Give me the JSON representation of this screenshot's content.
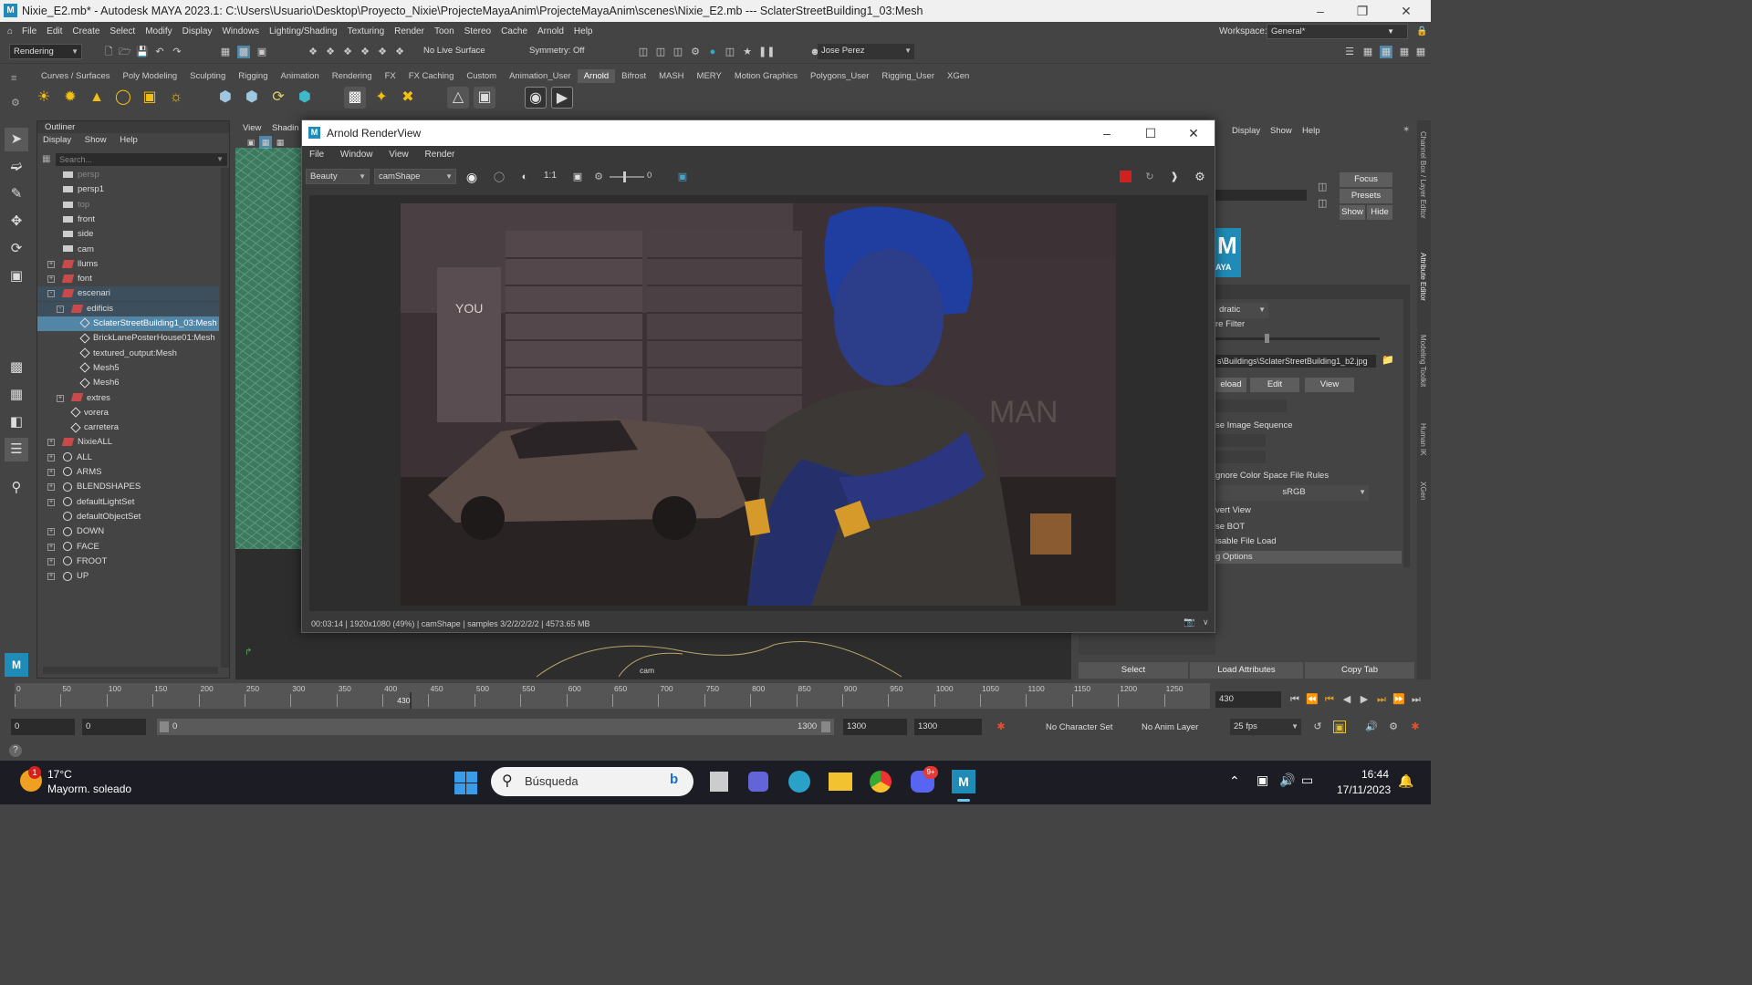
{
  "window": {
    "title": "Nixie_E2.mb* - Autodesk MAYA 2023.1: C:\\Users\\Usuario\\Desktop\\Proyecto_Nixie\\ProjecteMayaAnim\\ProjecteMayaAnim\\scenes\\Nixie_E2.mb   ---   SclaterStreetBuilding1_03:Mesh",
    "logo": "M"
  },
  "menubar": {
    "items": [
      "File",
      "Edit",
      "Create",
      "Select",
      "Modify",
      "Display",
      "Windows",
      "Lighting/Shading",
      "Texturing",
      "Render",
      "Toon",
      "Stereo",
      "Cache",
      "Arnold",
      "Help"
    ],
    "workspace_label": "Workspace:",
    "workspace_value": "General*"
  },
  "statusline": {
    "menuset": "Rendering",
    "live_surface": "No Live Surface",
    "symmetry": "Symmetry: Off",
    "user": "Jose Perez"
  },
  "shelf": {
    "tabs": [
      "Curves / Surfaces",
      "Poly Modeling",
      "Sculpting",
      "Rigging",
      "Animation",
      "Rendering",
      "FX",
      "FX Caching",
      "Custom",
      "Animation_User",
      "Arnold",
      "Bifrost",
      "MASH",
      "MERY",
      "Motion Graphics",
      "Polygons_User",
      "Rigging_User",
      "XGen"
    ],
    "active_tab": "Arnold"
  },
  "outliner": {
    "title": "Outliner",
    "menu": [
      "Display",
      "Show",
      "Help"
    ],
    "search_placeholder": "Search...",
    "items": [
      {
        "label": "persp",
        "type": "camera",
        "indent": 0,
        "dim": true
      },
      {
        "label": "persp1",
        "type": "camera",
        "indent": 0
      },
      {
        "label": "top",
        "type": "camera",
        "indent": 0,
        "dim": true
      },
      {
        "label": "front",
        "type": "camera",
        "indent": 0
      },
      {
        "label": "side",
        "type": "camera",
        "indent": 0
      },
      {
        "label": "cam",
        "type": "camera",
        "indent": 0
      },
      {
        "label": "llums",
        "type": "group",
        "indent": 0,
        "expand": "+"
      },
      {
        "label": "font",
        "type": "group",
        "indent": 0,
        "expand": "+"
      },
      {
        "label": "escenari",
        "type": "group",
        "indent": 0,
        "expand": "-",
        "grp": true
      },
      {
        "label": "edificis",
        "type": "group",
        "indent": 1,
        "expand": "-",
        "grp": true
      },
      {
        "label": "SclaterStreetBuilding1_03:Mesh",
        "type": "mesh",
        "indent": 2,
        "selected": true
      },
      {
        "label": "BrickLanePosterHouse01:Mesh",
        "type": "mesh",
        "indent": 2
      },
      {
        "label": "textured_output:Mesh",
        "type": "mesh",
        "indent": 2
      },
      {
        "label": "Mesh5",
        "type": "mesh",
        "indent": 2
      },
      {
        "label": "Mesh6",
        "type": "mesh",
        "indent": 2
      },
      {
        "label": "extres",
        "type": "group",
        "indent": 1,
        "expand": "+"
      },
      {
        "label": "vorera",
        "type": "mesh",
        "indent": 1
      },
      {
        "label": "carretera",
        "type": "mesh",
        "indent": 1
      },
      {
        "label": "NixieALL",
        "type": "group",
        "indent": 0,
        "expand": "+"
      },
      {
        "label": "ALL",
        "type": "set",
        "indent": 0,
        "expand": "+"
      },
      {
        "label": "ARMS",
        "type": "set",
        "indent": 0,
        "expand": "+"
      },
      {
        "label": "BLENDSHAPES",
        "type": "set",
        "indent": 0,
        "expand": "+"
      },
      {
        "label": "defaultLightSet",
        "type": "set",
        "indent": 0,
        "expand": "+"
      },
      {
        "label": "defaultObjectSet",
        "type": "set",
        "indent": 0
      },
      {
        "label": "DOWN",
        "type": "set",
        "indent": 0,
        "expand": "+"
      },
      {
        "label": "FACE",
        "type": "set",
        "indent": 0,
        "expand": "+"
      },
      {
        "label": "FROOT",
        "type": "set",
        "indent": 0,
        "expand": "+"
      },
      {
        "label": "UP",
        "type": "set",
        "indent": 0,
        "expand": "+"
      }
    ]
  },
  "viewport": {
    "menu": [
      "View",
      "Shadin"
    ],
    "camera_label": "cam"
  },
  "arnold": {
    "title": "Arnold RenderView",
    "menu": [
      "File",
      "Window",
      "View",
      "Render"
    ],
    "aov": "Beauty",
    "camera": "camShape",
    "zoom": "1:1",
    "exposure": "0",
    "status": "00:03:14 | 1920x1080 (49%) | camShape  | samples 3/2/2/2/2/2 | 4573.65 MB",
    "graffiti_1": "YOU",
    "graffiti_2": "MAN"
  },
  "right_panel": {
    "menu": [
      "Display",
      "Show",
      "Help"
    ],
    "buttons": [
      "Focus",
      "Presets",
      "Show",
      "Hide"
    ],
    "maya_logo": "M",
    "maya_text": "AYA",
    "filter_type": "dratic",
    "filter_label": "re Filter",
    "file_path": "s\\Buildings\\SclaterStreetBuilding1_b2.jpg",
    "file_buttons": [
      "eload",
      "Edit",
      "View"
    ],
    "use_image_seq": "se Image Sequence",
    "ignore_cs": "gnore Color Space File Rules",
    "color_space": "sRGB",
    "invert_view": "vert View",
    "use_bot": "se BOT",
    "disable_load": "isable File Load",
    "options": "g Options",
    "bottom_buttons": [
      "Select",
      "Load Attributes",
      "Copy Tab"
    ],
    "vertical_tabs": [
      "Channel Box / Layer Editor",
      "Attribute Editor",
      "Modeling Toolkit",
      "Human IK",
      "XGen"
    ]
  },
  "timeslider": {
    "ticks": [
      "0",
      "50",
      "100",
      "150",
      "200",
      "250",
      "300",
      "350",
      "400",
      "450",
      "500",
      "550",
      "600",
      "650",
      "700",
      "750",
      "800",
      "850",
      "900",
      "950",
      "1000",
      "1050",
      "1100",
      "1150",
      "1200",
      "1250"
    ],
    "current_frame": "430",
    "current_frame_field": "430"
  },
  "range": {
    "start": "0",
    "playback_start": "0",
    "slider_start": "0",
    "slider_end": "1300",
    "playback_end": "1300",
    "end": "1300",
    "character_set": "No Character Set",
    "anim_layer": "No Anim Layer",
    "fps": "25 fps"
  },
  "taskbar": {
    "temp": "17°C",
    "weather": "Mayorm. soleado",
    "search": "Búsqueda",
    "time": "16:44",
    "date": "17/11/2023",
    "discord_badge": "9+"
  }
}
